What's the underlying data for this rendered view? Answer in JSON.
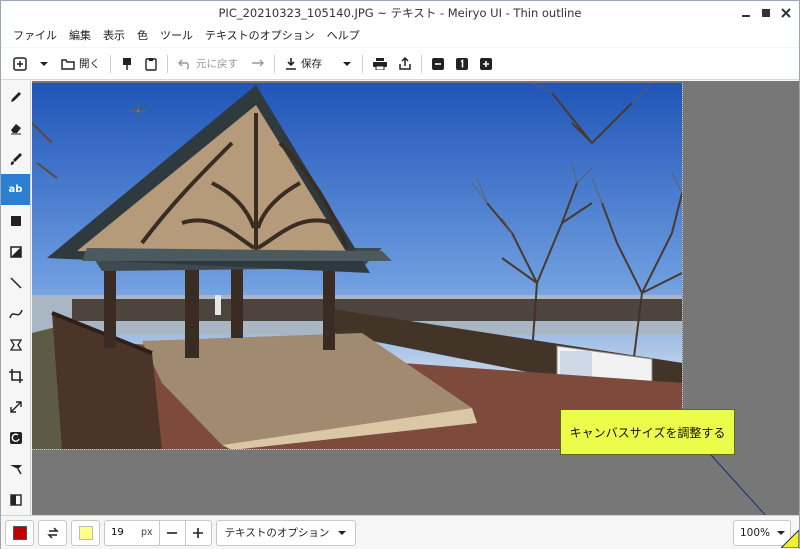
{
  "window": {
    "title": "PIC_20210323_105140.JPG ~ テキスト - Meiryo UI - Thin outline"
  },
  "menu": [
    "ファイル",
    "編集",
    "表示",
    "色",
    "ツール",
    "テキストのオプション",
    "ヘルプ"
  ],
  "toolbar": {
    "open_label": "開く",
    "undo_label": "元に戻す",
    "save_label": "保存"
  },
  "tools": [
    "pencil-icon",
    "eraser-icon",
    "brush-icon",
    "text-tool-icon",
    "rectangle-icon",
    "fill-icon",
    "line-icon",
    "curve-icon",
    "free-select-icon",
    "crop-icon",
    "resize-icon",
    "rotate-icon",
    "color-picker-icon",
    "contrast-icon"
  ],
  "text_tool_label": "ab",
  "callout": {
    "text": "キャンバスサイズを調整する"
  },
  "bottom": {
    "primary_color": "#c00000",
    "secondary_color": "#ffff88",
    "size_value": "19",
    "size_unit": "px",
    "text_options_label": "テキストのオプション",
    "zoom_value": "100%"
  },
  "colors": {
    "accent": "#2b7fd0",
    "callout_bg": "#ecfc4a",
    "workspace_bg": "#777777"
  }
}
